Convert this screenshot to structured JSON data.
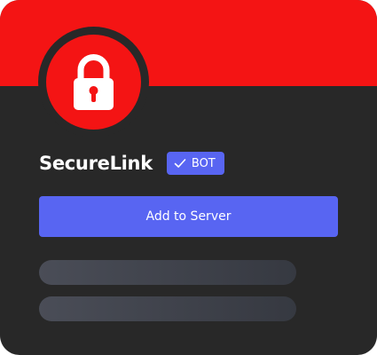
{
  "colors": {
    "banner": "#f41414",
    "card_background": "#282828",
    "accent": "#5865f2",
    "text": "#ffffff",
    "skeleton": "#4a4d57"
  },
  "profile": {
    "avatar_icon": "lock-icon",
    "name": "SecureLink",
    "badge": {
      "icon": "checkmark-icon",
      "label": "BOT"
    }
  },
  "actions": {
    "add_to_server_label": "Add to Server"
  }
}
